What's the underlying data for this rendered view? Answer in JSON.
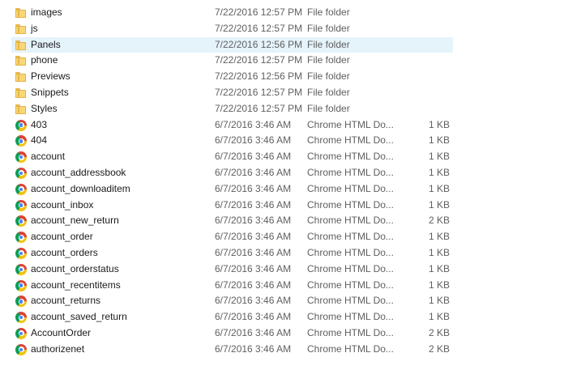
{
  "files": [
    {
      "name": "images",
      "date": "7/22/2016 12:57 PM",
      "type": "File folder",
      "size": "",
      "icon": "folder-icon",
      "selected": false
    },
    {
      "name": "js",
      "date": "7/22/2016 12:57 PM",
      "type": "File folder",
      "size": "",
      "icon": "folder-icon",
      "selected": false
    },
    {
      "name": "Panels",
      "date": "7/22/2016 12:56 PM",
      "type": "File folder",
      "size": "",
      "icon": "folder-icon",
      "selected": true
    },
    {
      "name": "phone",
      "date": "7/22/2016 12:57 PM",
      "type": "File folder",
      "size": "",
      "icon": "folder-icon",
      "selected": false
    },
    {
      "name": "Previews",
      "date": "7/22/2016 12:56 PM",
      "type": "File folder",
      "size": "",
      "icon": "folder-icon",
      "selected": false
    },
    {
      "name": "Snippets",
      "date": "7/22/2016 12:57 PM",
      "type": "File folder",
      "size": "",
      "icon": "folder-icon",
      "selected": false
    },
    {
      "name": "Styles",
      "date": "7/22/2016 12:57 PM",
      "type": "File folder",
      "size": "",
      "icon": "folder-icon",
      "selected": false
    },
    {
      "name": "403",
      "date": "6/7/2016 3:46 AM",
      "type": "Chrome HTML Do...",
      "size": "1 KB",
      "icon": "chrome-icon",
      "selected": false
    },
    {
      "name": "404",
      "date": "6/7/2016 3:46 AM",
      "type": "Chrome HTML Do...",
      "size": "1 KB",
      "icon": "chrome-icon",
      "selected": false
    },
    {
      "name": "account",
      "date": "6/7/2016 3:46 AM",
      "type": "Chrome HTML Do...",
      "size": "1 KB",
      "icon": "chrome-icon",
      "selected": false
    },
    {
      "name": "account_addressbook",
      "date": "6/7/2016 3:46 AM",
      "type": "Chrome HTML Do...",
      "size": "1 KB",
      "icon": "chrome-icon",
      "selected": false
    },
    {
      "name": "account_downloaditem",
      "date": "6/7/2016 3:46 AM",
      "type": "Chrome HTML Do...",
      "size": "1 KB",
      "icon": "chrome-icon",
      "selected": false
    },
    {
      "name": "account_inbox",
      "date": "6/7/2016 3:46 AM",
      "type": "Chrome HTML Do...",
      "size": "1 KB",
      "icon": "chrome-icon",
      "selected": false
    },
    {
      "name": "account_new_return",
      "date": "6/7/2016 3:46 AM",
      "type": "Chrome HTML Do...",
      "size": "2 KB",
      "icon": "chrome-icon",
      "selected": false
    },
    {
      "name": "account_order",
      "date": "6/7/2016 3:46 AM",
      "type": "Chrome HTML Do...",
      "size": "1 KB",
      "icon": "chrome-icon",
      "selected": false
    },
    {
      "name": "account_orders",
      "date": "6/7/2016 3:46 AM",
      "type": "Chrome HTML Do...",
      "size": "1 KB",
      "icon": "chrome-icon",
      "selected": false
    },
    {
      "name": "account_orderstatus",
      "date": "6/7/2016 3:46 AM",
      "type": "Chrome HTML Do...",
      "size": "1 KB",
      "icon": "chrome-icon",
      "selected": false
    },
    {
      "name": "account_recentitems",
      "date": "6/7/2016 3:46 AM",
      "type": "Chrome HTML Do...",
      "size": "1 KB",
      "icon": "chrome-icon",
      "selected": false
    },
    {
      "name": "account_returns",
      "date": "6/7/2016 3:46 AM",
      "type": "Chrome HTML Do...",
      "size": "1 KB",
      "icon": "chrome-icon",
      "selected": false
    },
    {
      "name": "account_saved_return",
      "date": "6/7/2016 3:46 AM",
      "type": "Chrome HTML Do...",
      "size": "1 KB",
      "icon": "chrome-icon",
      "selected": false
    },
    {
      "name": "AccountOrder",
      "date": "6/7/2016 3:46 AM",
      "type": "Chrome HTML Do...",
      "size": "2 KB",
      "icon": "chrome-icon",
      "selected": false
    },
    {
      "name": "authorizenet",
      "date": "6/7/2016 3:46 AM",
      "type": "Chrome HTML Do...",
      "size": "2 KB",
      "icon": "chrome-icon",
      "selected": false
    }
  ],
  "colors": {
    "selection": "#e5f3fb",
    "text_primary": "#1a1a1a",
    "text_secondary": "#5f5f5f",
    "folder": "#f8d775"
  }
}
